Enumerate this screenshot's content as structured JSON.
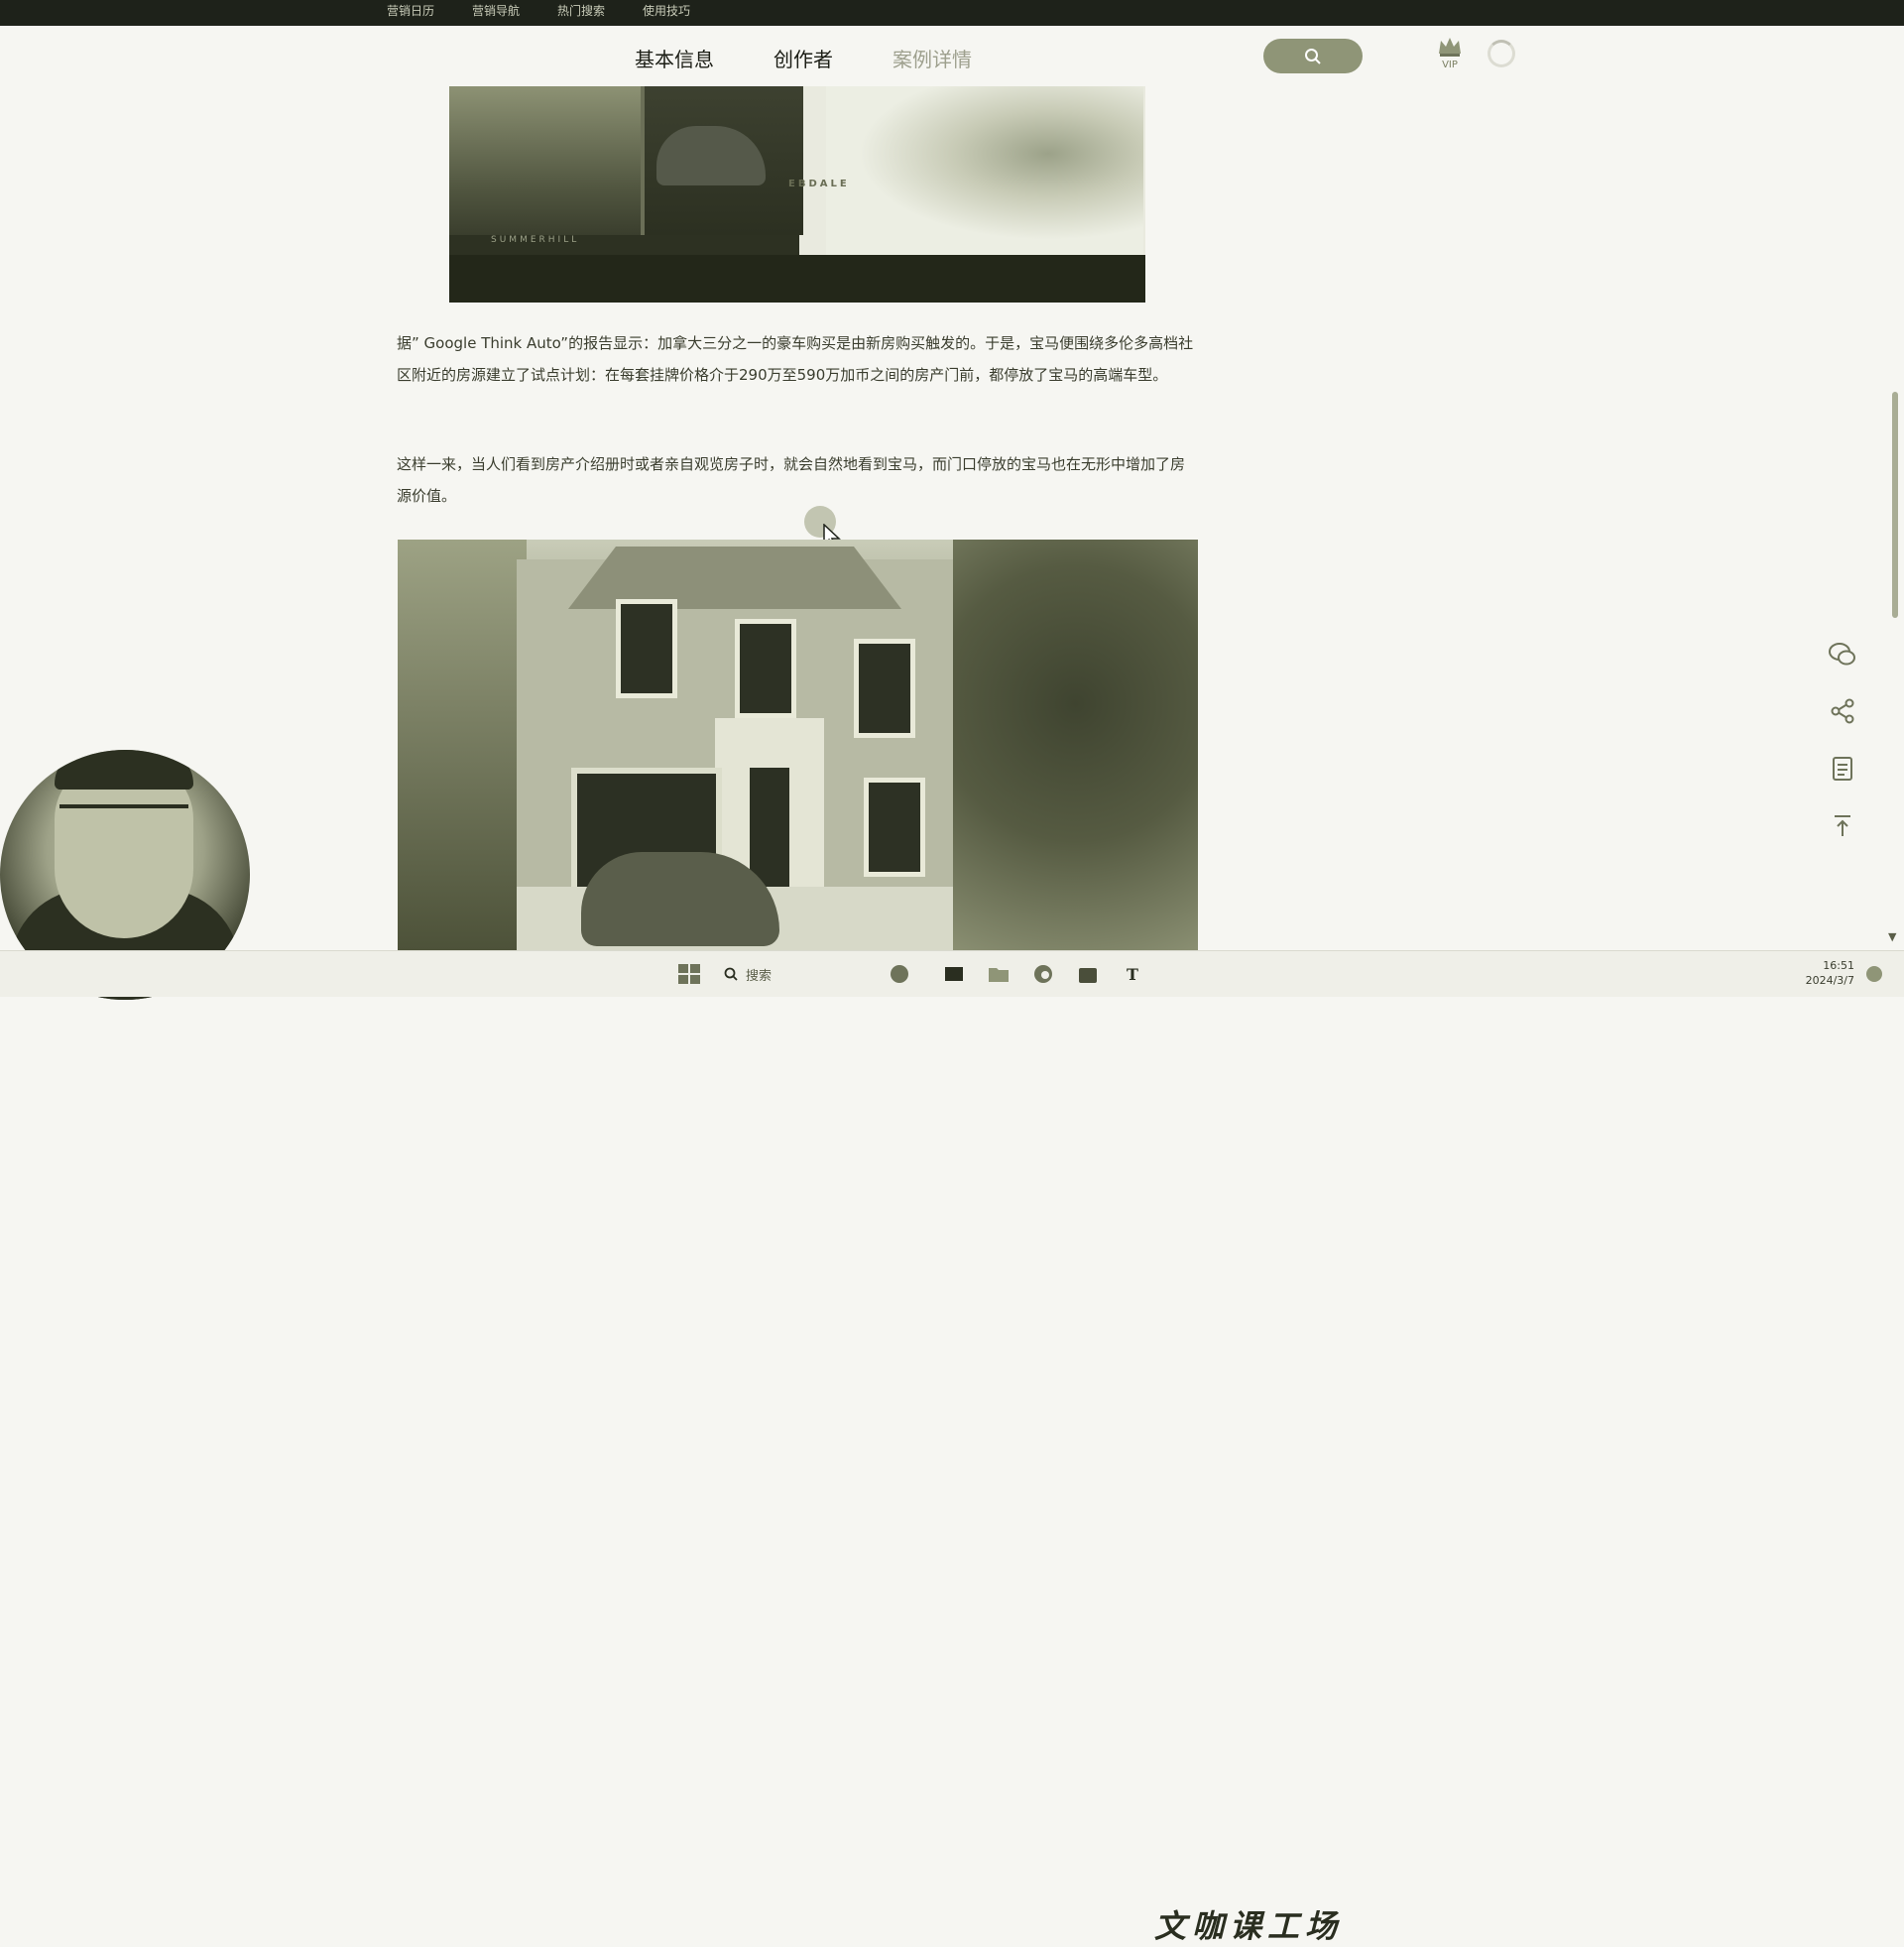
{
  "topbar": {
    "links": [
      "营销日历",
      "营销导航",
      "热门搜索",
      "使用技巧"
    ]
  },
  "nav": {
    "tabs": [
      "基本信息",
      "创作者",
      "案例详情"
    ],
    "vip_label": "VIP"
  },
  "image1": {
    "caption_left": "SUMMERHILL",
    "caption_right": "EBDALE"
  },
  "article": {
    "p1": "据” Google Think Auto”的报告显示：加拿大三分之一的豪车购买是由新房购买触发的。于是，宝马便围绕多伦多高档社区附近的房源建立了试点计划：在每套挂牌价格介于290万至590万加币之间的房产门前，都停放了宝马的高端车型。",
    "p2": "这样一来，当人们看到房产介绍册时或者亲自观览房子时，就会自然地看到宝马，而门口停放的宝马也在无形中增加了房源价值。"
  },
  "taskbar": {
    "search_label": "搜索",
    "time": "16:51",
    "date": "2024/3/7",
    "watermark": "文咖课工场"
  },
  "colors": {
    "topbar_bg": "#1e221a",
    "search_button": "#8f9577",
    "page_bg": "#f6f6f2"
  }
}
